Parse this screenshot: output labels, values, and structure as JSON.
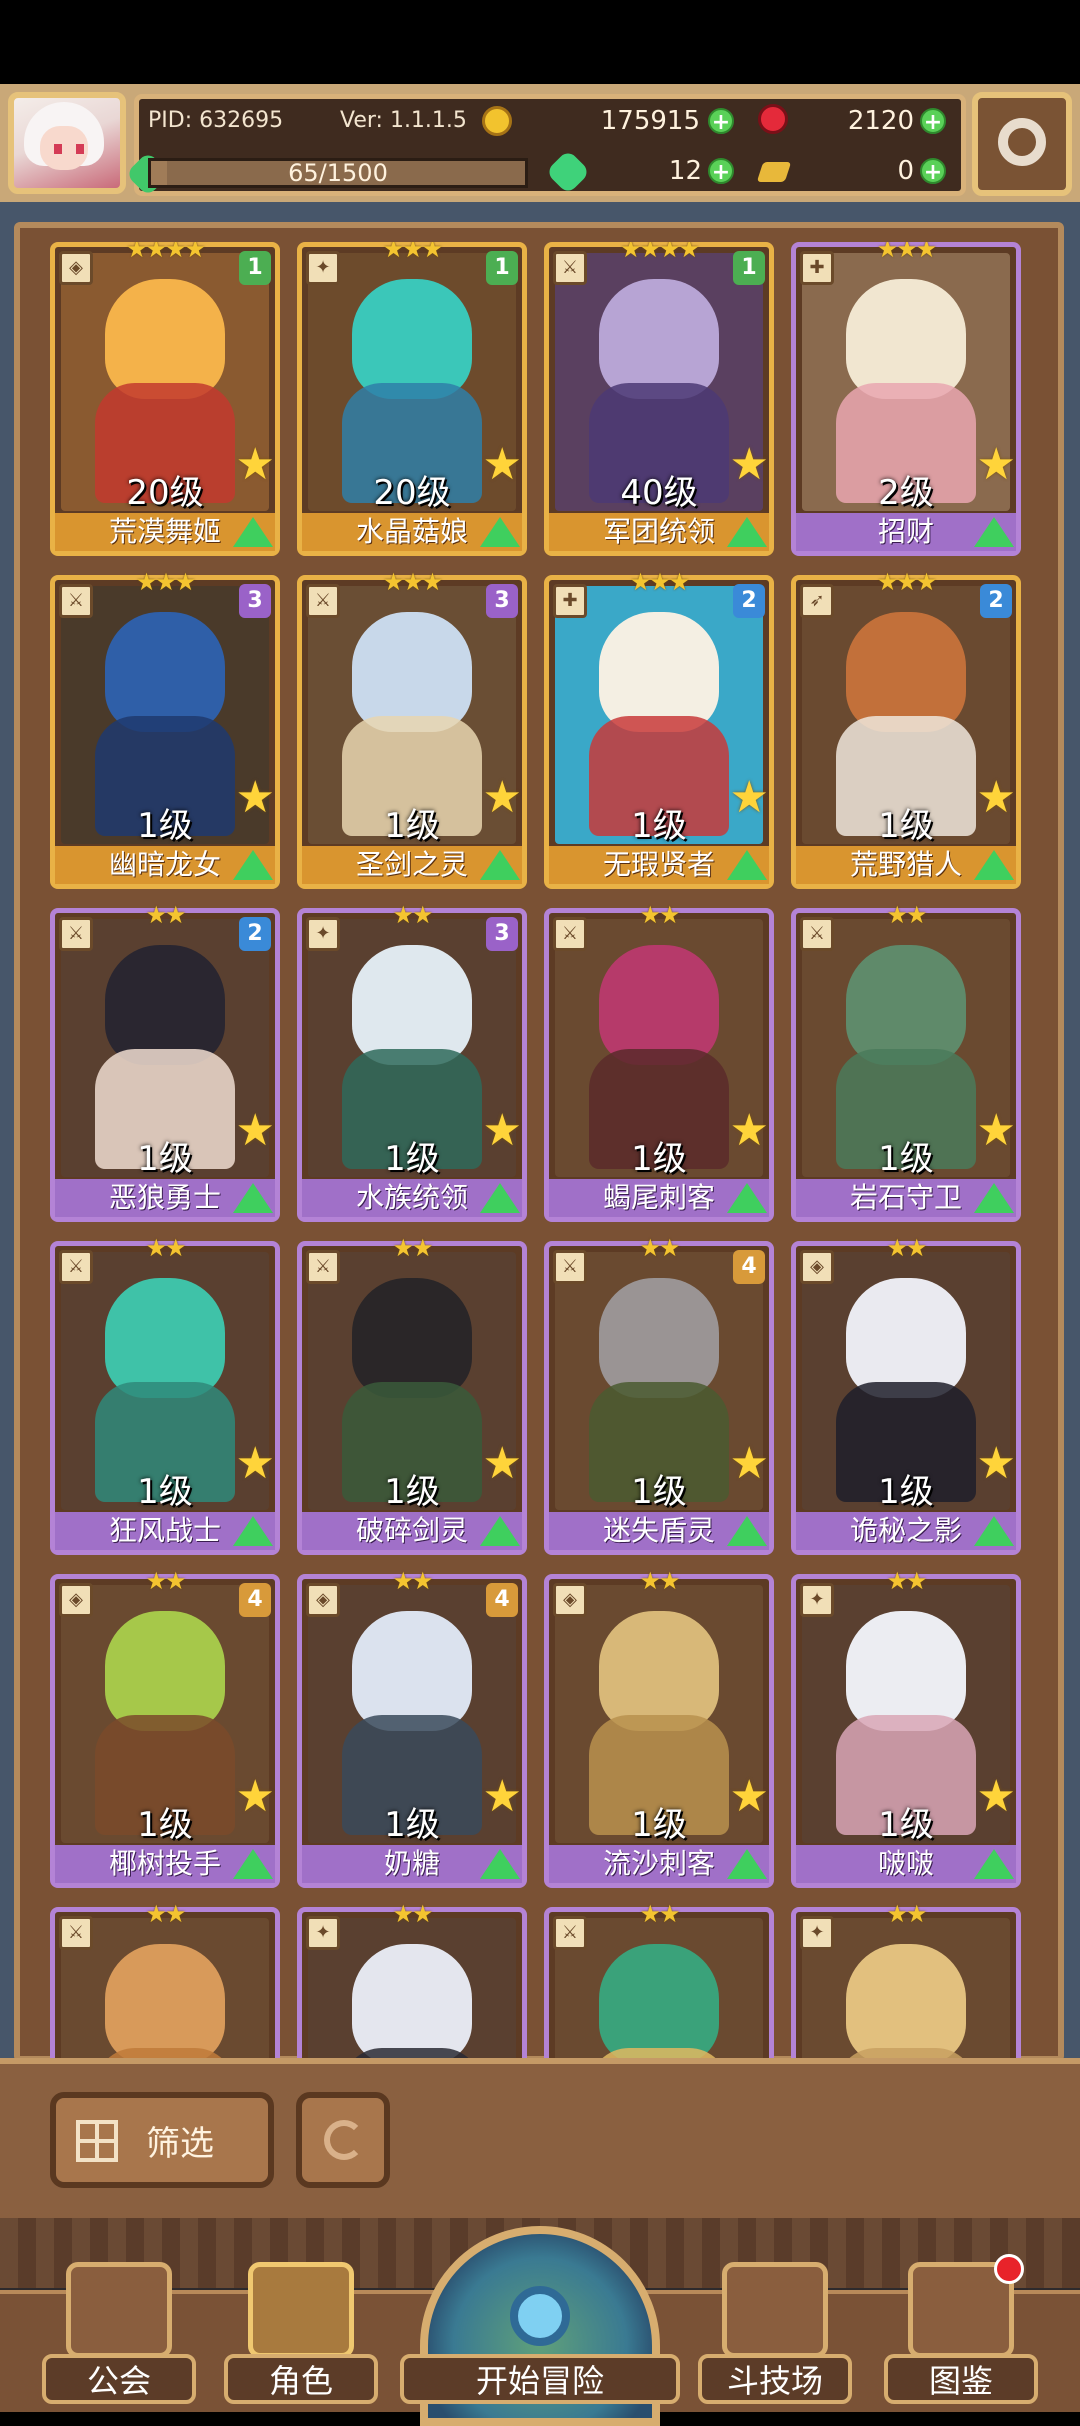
{
  "header": {
    "pid": "PID: 632695",
    "version": "Ver: 1.1.1.5",
    "coins": "175915",
    "rubies": "2120",
    "exp_text": "65/1500",
    "exp_fraction": 0.043,
    "clovers": "12",
    "keys": "0"
  },
  "cards": [
    {
      "name": "荒漠舞姬",
      "level": "20级",
      "stars": "★★★★",
      "badge": "1",
      "frame": "gold",
      "class_icon": "shield-icon",
      "colors": [
        "#f4b24a",
        "#c23a2e",
        "#8a5a30"
      ]
    },
    {
      "name": "水晶菇娘",
      "level": "20级",
      "stars": "★★★",
      "badge": "1",
      "frame": "gold",
      "class_icon": "staff-icon",
      "colors": [
        "#3bc7b9",
        "#2f7fa8",
        "#6d4b2c"
      ]
    },
    {
      "name": "军团统领",
      "level": "40级",
      "stars": "★★★★",
      "badge": "1",
      "frame": "gold",
      "class_icon": "sword-icon",
      "colors": [
        "#b7a4d4",
        "#4c3a74",
        "#5a4060"
      ]
    },
    {
      "name": "招财",
      "level": "2级",
      "stars": "★★★",
      "badge": "",
      "frame": "purple",
      "class_icon": "cross-icon",
      "colors": [
        "#f1e6d0",
        "#e9a6b0",
        "#8a6a4e"
      ]
    },
    {
      "name": "幽暗龙女",
      "level": "1级",
      "stars": "★★★",
      "badge": "3",
      "frame": "gold",
      "class_icon": "sword-icon",
      "colors": [
        "#2f5fa8",
        "#1f3a6e",
        "#4a3a2a"
      ]
    },
    {
      "name": "圣剑之灵",
      "level": "1级",
      "stars": "★★★",
      "badge": "3",
      "frame": "gold",
      "class_icon": "sword-icon",
      "colors": [
        "#c8d8ea",
        "#e8d6b0",
        "#6a4e34"
      ]
    },
    {
      "name": "无瑕贤者",
      "level": "1级",
      "stars": "★★★",
      "badge": "2",
      "frame": "gold",
      "class_icon": "cross-icon",
      "colors": [
        "#f4efe3",
        "#c83a3a",
        "#3aa8c8"
      ]
    },
    {
      "name": "荒野猎人",
      "level": "1级",
      "stars": "★★★",
      "badge": "2",
      "frame": "gold",
      "class_icon": "bow-icon",
      "colors": [
        "#c2703a",
        "#eee6dc",
        "#6a4a30"
      ]
    },
    {
      "name": "恶狼勇士",
      "level": "1级",
      "stars": "★★",
      "badge": "2",
      "frame": "purple",
      "class_icon": "sword-icon",
      "colors": [
        "#2a2630",
        "#f0ddd0",
        "#5a4030"
      ]
    },
    {
      "name": "水族统领",
      "level": "1级",
      "stars": "★★",
      "badge": "3",
      "frame": "purple",
      "class_icon": "staff-icon",
      "colors": [
        "#dfe8ee",
        "#2f6a5a",
        "#5a4030"
      ]
    },
    {
      "name": "蝎尾刺客",
      "level": "1级",
      "stars": "★★",
      "badge": "",
      "frame": "purple",
      "class_icon": "sword-icon",
      "colors": [
        "#b63a6a",
        "#5a2a2a",
        "#6a4a30"
      ]
    },
    {
      "name": "岩石守卫",
      "level": "1级",
      "stars": "★★",
      "badge": "",
      "frame": "purple",
      "class_icon": "sword-icon",
      "colors": [
        "#5f8a6a",
        "#4a7a5a",
        "#6a4a30"
      ]
    },
    {
      "name": "狂风战士",
      "level": "1级",
      "stars": "★★",
      "badge": "",
      "frame": "purple",
      "class_icon": "sword-icon",
      "colors": [
        "#3fc2a8",
        "#2f8a7a",
        "#5a4030"
      ]
    },
    {
      "name": "破碎剑灵",
      "level": "1级",
      "stars": "★★",
      "badge": "",
      "frame": "purple",
      "class_icon": "sword-icon",
      "colors": [
        "#2a2628",
        "#3a5a3a",
        "#5a4030"
      ]
    },
    {
      "name": "迷失盾灵",
      "level": "1级",
      "stars": "★★",
      "badge": "4",
      "frame": "purple",
      "class_icon": "sword-icon",
      "colors": [
        "#9a9494",
        "#4a5a30",
        "#6a4a30"
      ]
    },
    {
      "name": "诡秘之影",
      "level": "1级",
      "stars": "★★",
      "badge": "",
      "frame": "purple",
      "class_icon": "shield-icon",
      "colors": [
        "#eaeaf0",
        "#1e1e2a",
        "#5a4030"
      ]
    },
    {
      "name": "椰树投手",
      "level": "1级",
      "stars": "★★",
      "badge": "4",
      "frame": "purple",
      "class_icon": "shield-icon",
      "colors": [
        "#a6c84a",
        "#7a4a2a",
        "#6a4a30"
      ]
    },
    {
      "name": "奶糖",
      "level": "1级",
      "stars": "★★",
      "badge": "4",
      "frame": "purple",
      "class_icon": "shield-icon",
      "colors": [
        "#dbe2ee",
        "#3a4a5a",
        "#5a4030"
      ]
    },
    {
      "name": "流沙刺客",
      "level": "1级",
      "stars": "★★",
      "badge": "",
      "frame": "purple",
      "class_icon": "shield-icon",
      "colors": [
        "#d8b878",
        "#b8904e",
        "#6a4a30"
      ]
    },
    {
      "name": "啵啵",
      "level": "1级",
      "stars": "★★",
      "badge": "",
      "frame": "purple",
      "class_icon": "staff-icon",
      "colors": [
        "#ecedf2",
        "#d9a6b6",
        "#5a4030"
      ]
    },
    {
      "name": "",
      "level": "",
      "stars": "★★",
      "badge": "",
      "frame": "purple",
      "class_icon": "sword-icon",
      "colors": [
        "#d89a5a",
        "#c07a3a",
        "#6a4a30"
      ]
    },
    {
      "name": "",
      "level": "",
      "stars": "★★",
      "badge": "",
      "frame": "purple",
      "class_icon": "staff-icon",
      "colors": [
        "#e4e6ee",
        "#2a2a34",
        "#5a4030"
      ]
    },
    {
      "name": "",
      "level": "",
      "stars": "★★",
      "badge": "",
      "frame": "purple",
      "class_icon": "sword-icon",
      "colors": [
        "#3aa27a",
        "#e0b860",
        "#6a4a30"
      ]
    },
    {
      "name": "",
      "level": "",
      "stars": "★★",
      "badge": "",
      "frame": "purple",
      "class_icon": "staff-icon",
      "colors": [
        "#e2c07e",
        "#c8a060",
        "#6a4a30"
      ]
    }
  ],
  "controls": {
    "filter_label": "筛选"
  },
  "nav": {
    "guild": "公会",
    "character": "角色",
    "adventure": "开始冒险",
    "arena": "斗技场",
    "codex": "图鉴"
  },
  "colors": {
    "accent_gold": "#e9b246",
    "frame_purple": "#b483d6",
    "plus_green": "#5ad158"
  }
}
